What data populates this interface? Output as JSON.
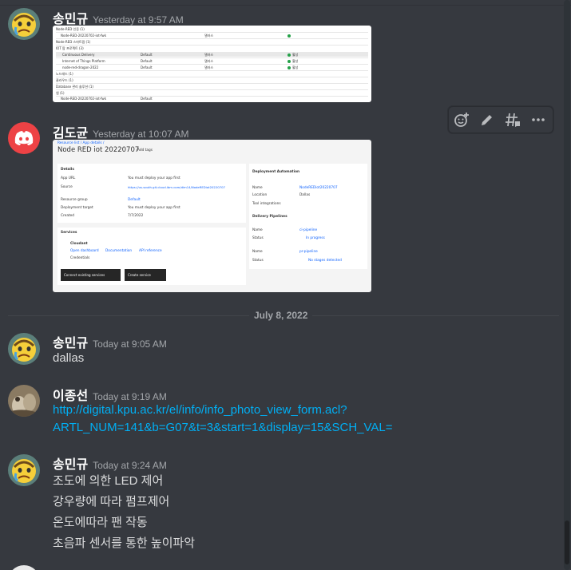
{
  "messages": [
    {
      "author": "송민규",
      "timestamp": "Yesterday at 9:57 AM"
    },
    {
      "author": "김도균",
      "timestamp": "Yesterday at 10:07 AM"
    },
    {
      "author": "송민규",
      "timestamp": "Today at 9:05 AM",
      "text": "dallas"
    },
    {
      "author": "이종선",
      "timestamp": "Today at 9:19 AM",
      "link_line1": "http://digital.kpu.ac.kr/el/info/info_photo_view_form.acl?",
      "link_line2": "ARTL_NUM=141&b=G07&t=3&start=1&display=15&SCH_VAL="
    },
    {
      "author": "송민규",
      "timestamp": "Today at 9:24 AM",
      "lines": [
        "조도에 의한  LED 제어",
        "강우량에 따라 펌프제어",
        "온도에따라 팬 작동",
        "초음파 센서를 통한 높이파악"
      ]
    }
  ],
  "date_divider": "July 8, 2022",
  "toolbar": {
    "icons": [
      "add-reaction-icon",
      "edit-icon",
      "create-thread-icon",
      "more-icon"
    ]
  },
  "shot1": {
    "rows": [
      "Node-RED 인증 (1)",
      "Node-RED-20220702-iot-fwk",
      "Node-RED 스마트팜 (1)",
      "IOT 팜 프로젝트 (3)",
      "Continuous Delivery",
      "Internet of Things Platform",
      "node-red-dragon-2022",
      "노드레드 (1)",
      "클라우드 (1)",
      "Database 관리 솔루션 (1)",
      "앱 (1)",
      "Node-RED-20220702-iot-fwk"
    ],
    "col_default": "Default",
    "col_region": "댈러스",
    "col_status": "활성"
  },
  "shot2": {
    "breadcrumb": "Resource list  /  App details  /",
    "title": "Node RED iot 20220707",
    "add_tags": "Add tags",
    "details_title": "Details",
    "app_url_label": "App URL",
    "app_url_value": "You must deploy your app first",
    "source_label": "Source",
    "source_value": "https://us-south.git.cloud.ibm.com/dim14/NodeREDiot20220707",
    "rg_label": "Resource group",
    "rg_value": "Default",
    "dt_label": "Deployment target",
    "dt_value": "You must deploy your app first",
    "created_label": "Created",
    "created_value": "7/7/2022",
    "services_title": "Services",
    "service_name": "Cloudant",
    "open_dashboard": "Open dashboard",
    "documentation": "Documentation",
    "api_reference": "API reference",
    "credentials": "Credentials",
    "connect_btn": "Connect existing services",
    "create_btn": "Create service",
    "da_title": "Deployment Automation",
    "name_label": "Name",
    "name_value": "NodeREDiot20220707",
    "location_label": "Location",
    "location_value": "Dallas",
    "tool_label": "Tool integrations",
    "pipelines_title": "Delivery Pipelines",
    "p1_name": "ci-pipeline",
    "status_label": "Status",
    "p1_status": "In progress",
    "p2_name": "pr-pipeline",
    "p2_status": "No stages detected"
  }
}
